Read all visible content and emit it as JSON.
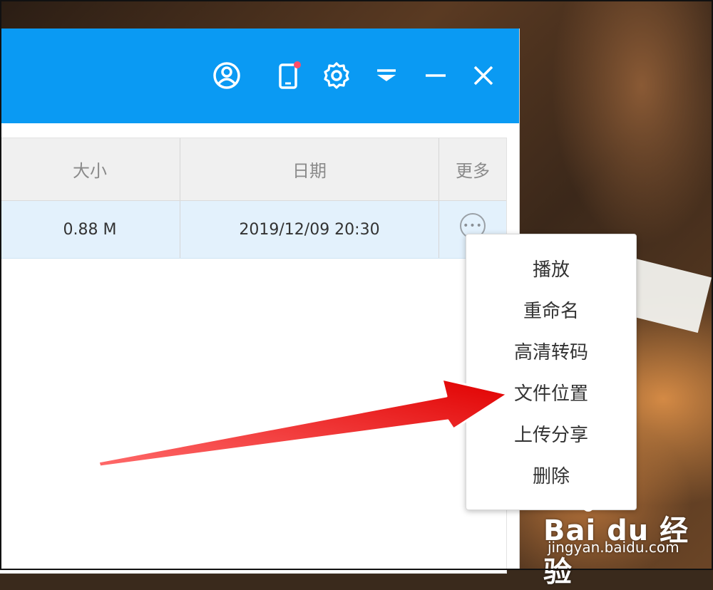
{
  "titlebar": {
    "color": "#0a9af3",
    "buttons": [
      {
        "icon": "user-icon"
      },
      {
        "icon": "phone-icon",
        "badge_color": "#ff4d6a"
      },
      {
        "icon": "gear-icon"
      },
      {
        "icon": "dropdown-icon"
      },
      {
        "icon": "minimize-icon"
      },
      {
        "icon": "close-icon"
      }
    ]
  },
  "table": {
    "headers": {
      "size": "大小",
      "date": "日期",
      "more": "更多"
    },
    "row": {
      "size": "0.88 M",
      "date": "2019/12/09 20:30",
      "more_glyph": "•••"
    }
  },
  "context_menu": {
    "items": [
      "播放",
      "重命名",
      "高清转码",
      "文件位置",
      "上传分享",
      "删除"
    ]
  },
  "annotation": {
    "arrow_color": "#ff0a0a",
    "arrow_target": "文件位置"
  },
  "watermark": {
    "logo": "Bai du 经验",
    "url": "jingyan.baidu.com"
  }
}
